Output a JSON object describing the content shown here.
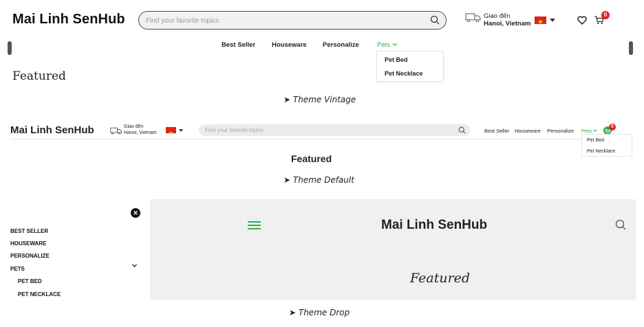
{
  "brand": {
    "name": "Mai Linh SenHub"
  },
  "search": {
    "placeholder": "Find your favorite topics"
  },
  "delivery": {
    "label": "Giao đến",
    "location": "Hanoi, Vietnam"
  },
  "cart": {
    "count": "0"
  },
  "nav": {
    "best_seller": "Best Seller",
    "houseware": "Houseware",
    "personalize": "Personalize",
    "pets": "Pets",
    "pets_menu": [
      "Pet Bed",
      "Pet Necklace"
    ]
  },
  "sidebar": {
    "items": [
      "BEST SELLER",
      "HOUSEWARE",
      "PERSONALIZE",
      "PETS"
    ],
    "sub_items": [
      "PET BED",
      "PET NECKLACE"
    ]
  },
  "featured": "Featured",
  "captions": {
    "vintage": "➤ Theme Vintage",
    "default": "➤ Theme Default",
    "drop": "➤ Theme Drop"
  },
  "colors": {
    "accent_green": "#31b050",
    "badge_red": "#e02020",
    "flag_red": "#da251d"
  }
}
